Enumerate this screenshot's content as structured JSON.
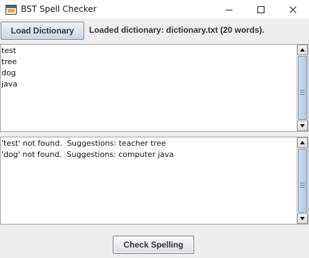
{
  "window": {
    "title": "BST Spell Checker",
    "controls": {
      "minimize": "minimize-icon",
      "maximize": "maximize-icon",
      "close": "close-icon"
    }
  },
  "toolbar": {
    "load_label": "Load Dictionary",
    "status": "Loaded dictionary: dictionary.txt (20 words)."
  },
  "input_area": {
    "lines": [
      "test",
      "tree",
      "dog",
      "java"
    ]
  },
  "output_area": {
    "lines": [
      "'test' not found.  Suggestions: teacher tree",
      "'dog' not found.  Suggestions: computer java"
    ]
  },
  "actions": {
    "check_label": "Check Spelling"
  },
  "colors": {
    "accent": "#0078d4",
    "thumb": "#b7cbe0",
    "background": "#eeeeee"
  }
}
